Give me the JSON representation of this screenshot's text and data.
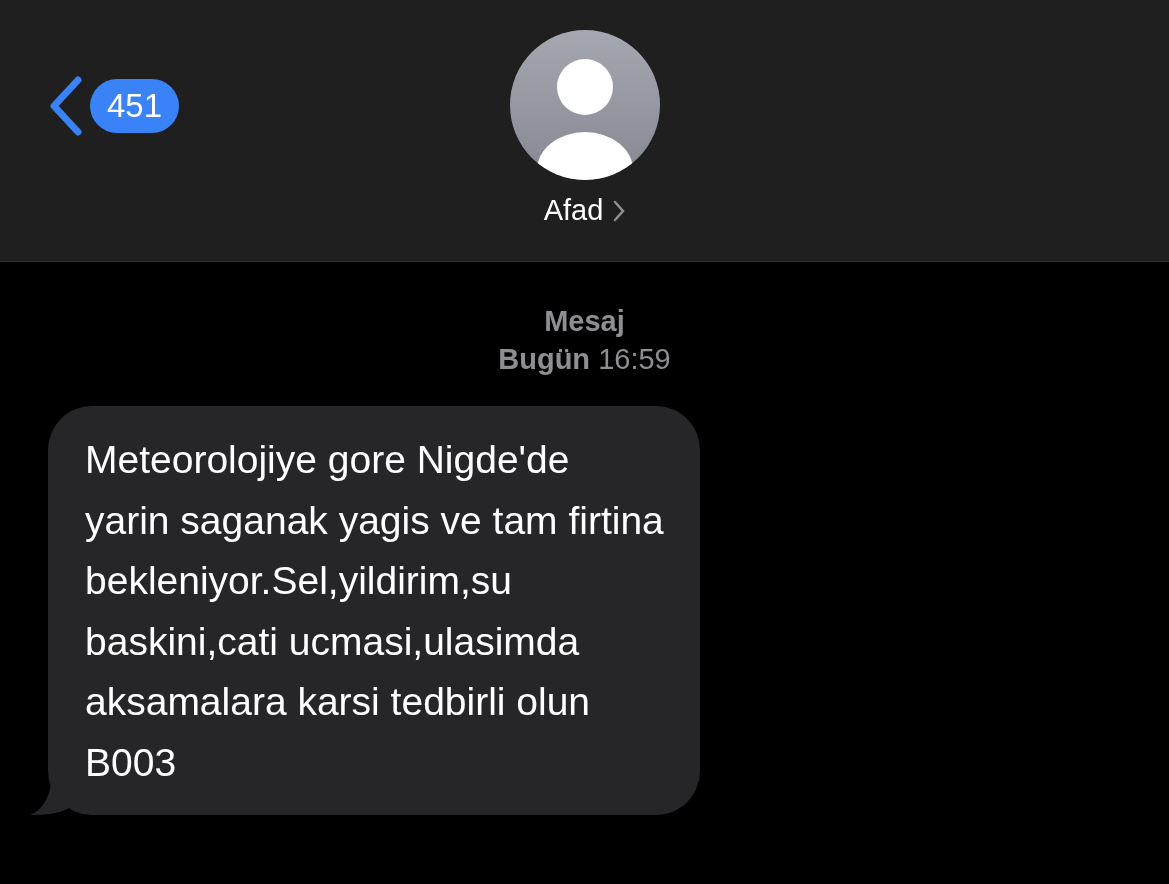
{
  "header": {
    "back_badge": "451",
    "contact_name": "Afad"
  },
  "conversation": {
    "service": "Mesaj",
    "timestamp": "**Bugün** 16:59"
  },
  "messages": [
    {
      "kind": "received",
      "text": "Meteorolojiye gore Nigde'de\nyarin saganak yagis ve tam firtina\nbekleniyor.Sel,yildirim,su\nbaskini,cati ucmasi,ulasimda\naksamalara karsi tedbirli olun\nB003"
    }
  ]
}
